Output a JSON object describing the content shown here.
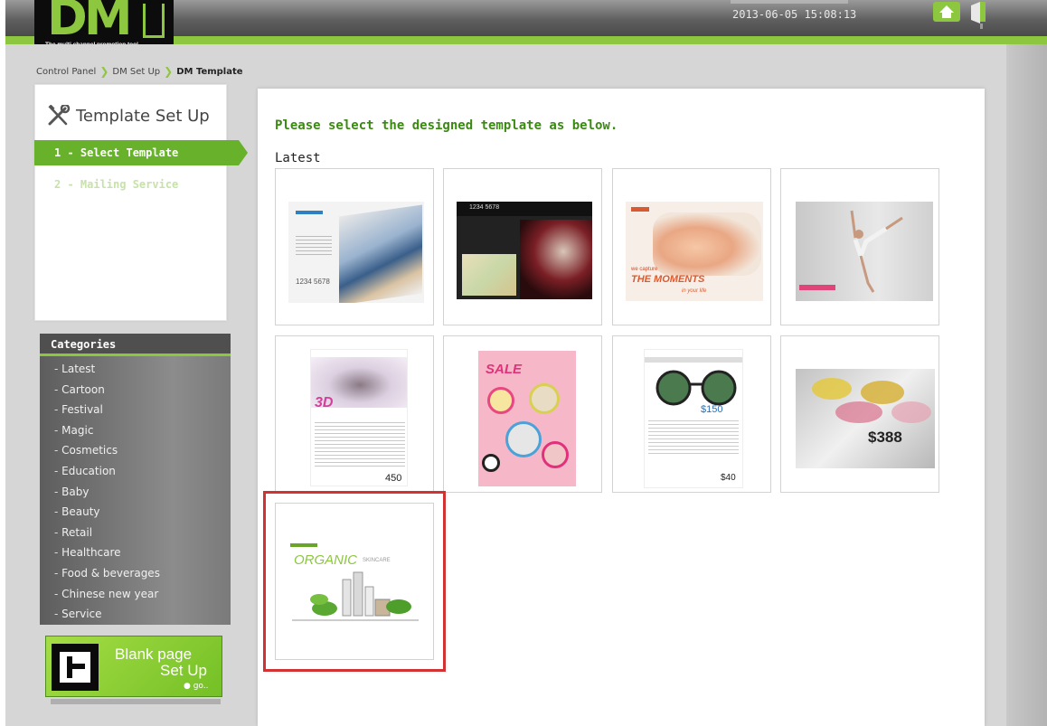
{
  "header": {
    "logo_text": "DM",
    "logo_tagline": "The multi channel promotion tool",
    "datetime": "2013-06-05 15:08:13"
  },
  "breadcrumb": [
    "Control Panel",
    "DM Set Up",
    "DM Template"
  ],
  "sidebar": {
    "title": "Template Set Up",
    "steps": [
      "1 - Select Template",
      "2 - Mailing Service"
    ],
    "categories_title": "Categories",
    "categories": [
      "Latest",
      "Cartoon",
      "Festival",
      "Magic",
      "Cosmetics",
      "Education",
      "Baby",
      "Beauty",
      "Retail",
      "Healthcare",
      "Food & beverages",
      "Chinese new year",
      "Service"
    ],
    "blank_page": {
      "line1": "Blank page",
      "line2": "Set Up",
      "go": "go.."
    }
  },
  "main": {
    "instruction": "Please select the designed template as below.",
    "section": "Latest",
    "thumb_texts": {
      "books_phone": "1234 5678",
      "wine_phone": "1234 5678",
      "baby_we": "we capture",
      "baby_main": "THE MOMENTS",
      "baby_sub": "in your life",
      "lash_3d": "3D",
      "lash_price": "450",
      "sale": "SALE",
      "glasses_price": "$150",
      "glasses_small": "$40",
      "frames_price": "$388",
      "organic": "ORGANIC",
      "skincare": "SKINCARE"
    },
    "selected_index": 8
  },
  "colors": {
    "accent_green": "#8dc63f",
    "step_green": "#67b12b",
    "highlight_red": "#d23232",
    "instruction_green": "#3a8a12"
  }
}
